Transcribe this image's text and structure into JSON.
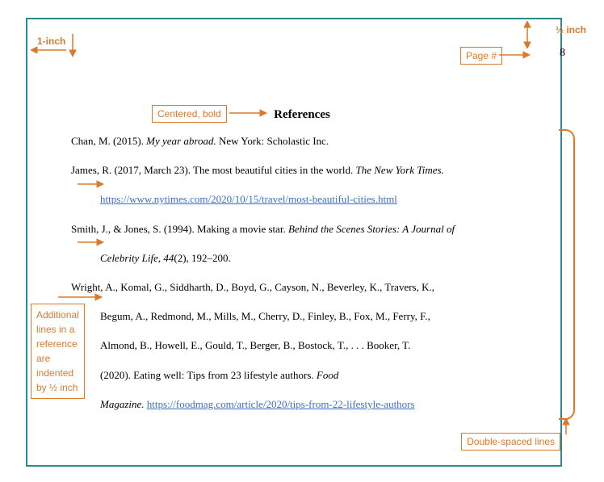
{
  "page_number": "8",
  "heading": "References",
  "references": {
    "r1": {
      "line1_a": "Chan, M. (2015). ",
      "line1_i": "My year abroad. ",
      "line1_b": "New York: Scholastic Inc."
    },
    "r2": {
      "line1_a": "James, R. (2017, March 23). The most beautiful cities in the world. ",
      "line1_i": "The New York Times.",
      "line2_link": "https://www.nytimes.com/2020/10/15/travel/most-beautiful-cities.html"
    },
    "r3": {
      "line1_a": "Smith, J., & Jones, S. (1994). Making a movie star. ",
      "line1_i": "Behind the Scenes Stories: A Journal of",
      "line2_i": "Celebrity Life, 44",
      "line2_b": "(2), 192–200."
    },
    "r4": {
      "line1": "Wright, A., Komal, G., Siddharth, D., Boyd, G., Cayson, N., Beverley, K., Travers, K.,",
      "line2": "Begum, A., Redmond, M., Mills, M., Cherry, D., Finley, B., Fox, M., Ferry, F.,",
      "line3": "Almond, B., Howell, E., Gould, T., Berger, B., Bostock, T., . . . Booker, T.",
      "line4_a": "(2020). Eating well: Tips from 23 lifestyle authors. ",
      "line4_i": "Food",
      "line5_i": "Magazine. ",
      "line5_link": "https://foodmag.com/article/2020/tips-from-22-lifestyle-authors"
    }
  },
  "callouts": {
    "one_inch": "1-inch",
    "half_inch": "½ inch",
    "page_num": "Page #",
    "centered_bold": "Centered, bold",
    "indent_note_l1": "Additional",
    "indent_note_l2": "lines in a",
    "indent_note_l3": "reference",
    "indent_note_l4": "are",
    "indent_note_l5": "indented",
    "indent_note_l6": "by ½ inch",
    "double_spaced": "Double-spaced lines"
  }
}
